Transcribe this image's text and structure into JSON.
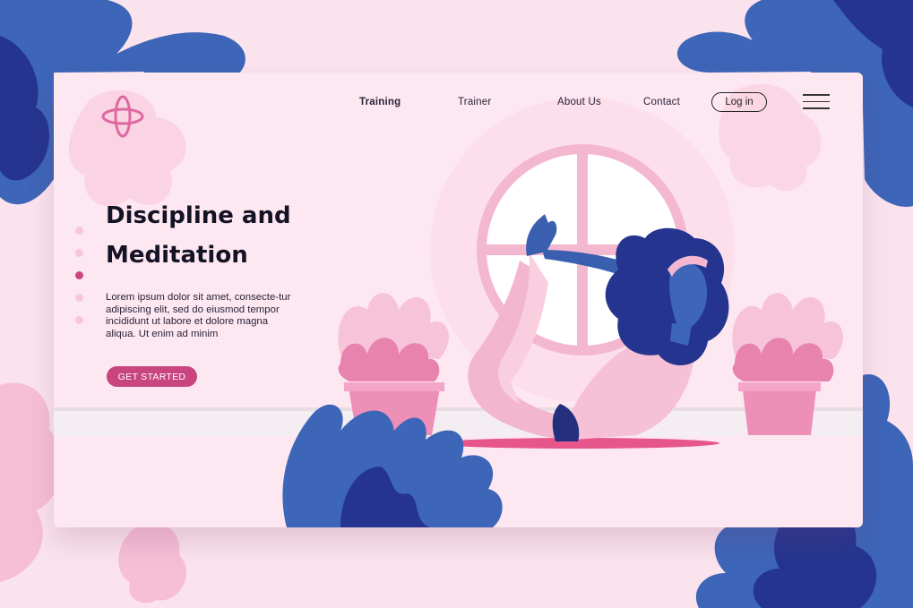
{
  "colors": {
    "page_bg": "#fbe3ee",
    "card_bg": "#fde7f1",
    "accent": "#c8457f",
    "navy": "#25358f",
    "blue": "#3d65b8",
    "pink": "#f3b7d0"
  },
  "logo": {
    "icon": "plus-cross-logo-icon"
  },
  "nav": {
    "items": [
      {
        "label": "Training",
        "active": true
      },
      {
        "label": "Trainer",
        "active": false
      },
      {
        "label": "About Us",
        "active": false
      },
      {
        "label": "Contact",
        "active": false
      }
    ],
    "login_label": "Log in",
    "menu_icon": "hamburger-menu-icon"
  },
  "hero": {
    "title_line1": "Discipline and",
    "title_line2": "Meditation",
    "body": "Lorem ipsum dolor sit amet, consecte-tur adipiscing elit, sed do eiusmod tempor incididunt ut labore et dolore magna aliqua. Ut enim ad minim",
    "cta_label": "GET STARTED"
  },
  "pagination": {
    "count": 5,
    "active_index": 2
  }
}
